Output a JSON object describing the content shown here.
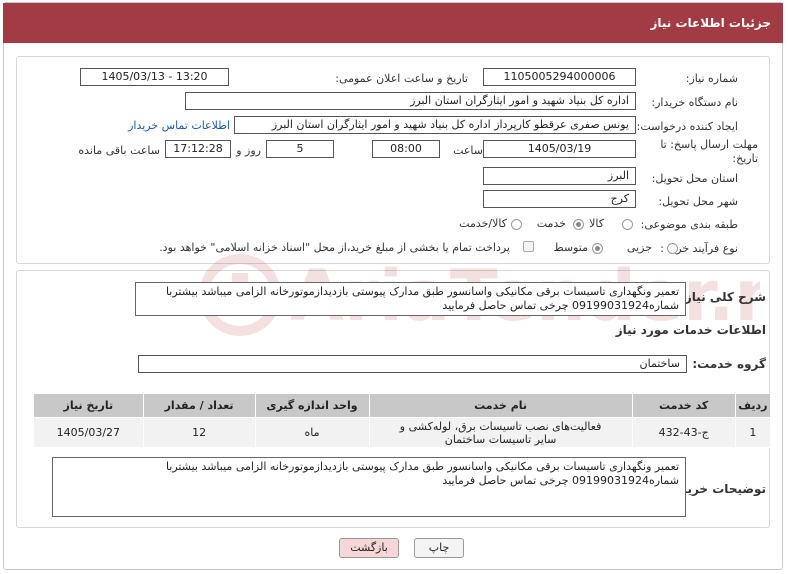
{
  "header": {
    "title": "جزئیات اطلاعات نیاز"
  },
  "fields": {
    "need_number_label": "شماره نیاز:",
    "need_number": "1105005294000006",
    "announce_label": "تاریخ و ساعت اعلان عمومی:",
    "announce_value": "1405/03/13 - 13:20",
    "buyer_org_label": "نام دستگاه خریدار:",
    "buyer_org": "اداره کل بنیاد شهید و امور ایثارگران استان البرز",
    "creator_label": "ایجاد کننده درخواست:",
    "creator": "یونس  صفری عرقطو کارپرداز اداره کل بنیاد شهید و امور ایثارگران استان البرز",
    "contact_link": "اطلاعات تماس خریدار",
    "deadline_label": "مهلت ارسال پاسخ: تا تاریخ:",
    "deadline_date": "1405/03/19",
    "time_label": "ساعت",
    "deadline_time": "08:00",
    "days_value": "5",
    "days_label": "روز و",
    "remaining_time": "17:12:28",
    "remaining_label": "ساعت باقی مانده",
    "province_label": "استان محل تحویل:",
    "province": "البرز",
    "city_label": "شهر محل تحویل:",
    "city": "کرج",
    "category_label": "طبقه بندی موضوعی:",
    "category_options": [
      "کالا",
      "خدمت",
      "کالا/خدمت"
    ],
    "category_selected": "خدمت",
    "process_label": "نوع فرآیند خرید :",
    "process_options": [
      "جزیی",
      "متوسط"
    ],
    "process_selected": "متوسط",
    "payment_note": "پرداخت تمام یا بخشی از مبلغ خرید،از محل \"اسناد خزانه اسلامی\" خواهد بود."
  },
  "need_desc": {
    "label": "شرح کلی نیاز:",
    "text": "تعمیر ونگهداری تاسیسات برقی مکانیکی واسانسور طبق مدارک پیوستی بازدیدازموتورخانه الزامی میباشد بیشتربا شماره09199031924 چرخی تماس حاصل فرمایید"
  },
  "services_title": "اطلاعات خدمات مورد نیاز",
  "service_group": {
    "label": "گروه خدمت:",
    "value": "ساختمان"
  },
  "table": {
    "headers": [
      "ردیف",
      "کد خدمت",
      "نام خدمت",
      "واحد اندازه گیری",
      "تعداد / مقدار",
      "تاریخ نیاز"
    ],
    "rows": [
      [
        "1",
        "ج-43-432",
        "فعالیت‌های نصب تاسیسات برق، لوله‌کشی و سایر تاسیسات ساختمان",
        "ماه",
        "12",
        "1405/03/27"
      ]
    ]
  },
  "buyer_notes": {
    "label": "توضیحات خریدار:",
    "text": "تعمیر ونگهداری تاسیسات برقی مکانیکی واسانسور طبق مدارک پیوستی بازدیدازموتورخانه الزامی میباشد بیشتربا شماره09199031924 چرخی تماس حاصل فرمایید"
  },
  "buttons": {
    "print": "چاپ",
    "back": "بازگشت"
  },
  "watermark_text": "AriaTender.net",
  "colors": {
    "header": "#a23b43",
    "watermark": "#b5161b"
  }
}
